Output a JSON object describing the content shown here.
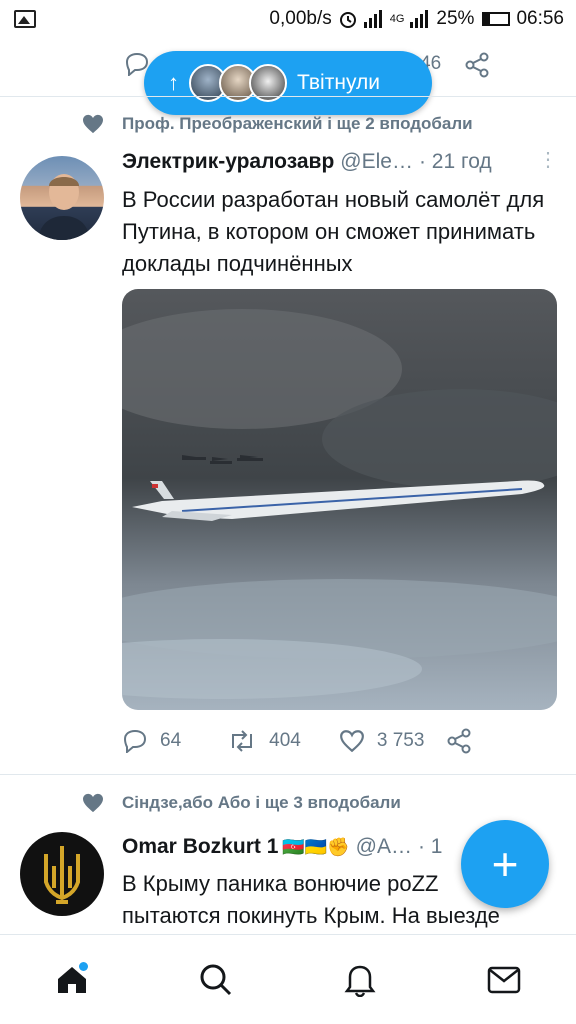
{
  "status_bar": {
    "speed": "0,00b/s",
    "network": "4G",
    "battery": "25%",
    "time": "06:56"
  },
  "prev_tweet": {
    "retweet_count": "46"
  },
  "pill": {
    "label": "Твітнули"
  },
  "tweet1": {
    "social_context": "Проф. Преображенский і ще 2 вподобали",
    "author_name": "Электрик-уралозавр",
    "handle": "@Ele…",
    "time": "· 21 год",
    "text": "В России разработан новый самолёт для Путина, в котором он сможет принимать доклады подчинённых",
    "replies": "64",
    "retweets": "404",
    "likes": "3 753"
  },
  "tweet2": {
    "social_context": "Сіндзе,або Або і ще 3 вподобали",
    "author_name": "Omar Bozkurt 1",
    "emojis": "🇦🇿🇺🇦✊",
    "handle": "@A…",
    "time": "· 1",
    "text_line1": "В Крыму паника вонючие poZZ",
    "text_line2": "пытаются покинуть Крым. На выезде"
  },
  "fab": {
    "label": "+"
  },
  "colors": {
    "accent": "#1da1f2",
    "muted": "#657786"
  }
}
